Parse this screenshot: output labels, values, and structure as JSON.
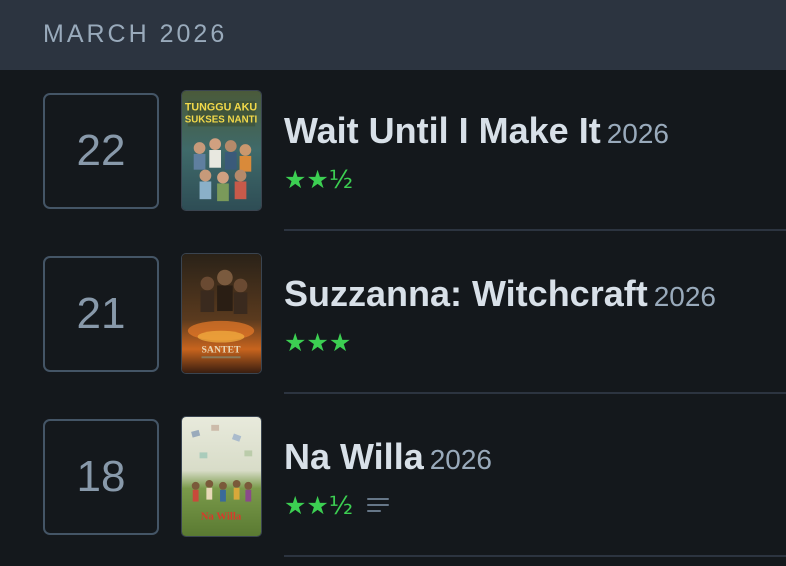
{
  "month_header": {
    "label": "MARCH 2026"
  },
  "entries": [
    {
      "day": "22",
      "title": "Wait Until I Make It",
      "year": "2026",
      "rating_stars": "★★½",
      "rating_value": 2.5,
      "has_review": false,
      "poster_text": "TUNGGU AKU SUKSES NANTI",
      "poster_icon": "poster-image"
    },
    {
      "day": "21",
      "title": "Suzzanna: Witchcraft",
      "year": "2026",
      "rating_stars": "★★★",
      "rating_value": 3,
      "has_review": false,
      "poster_text": "SANTET",
      "poster_icon": "poster-image"
    },
    {
      "day": "18",
      "title": "Na Willa",
      "year": "2026",
      "rating_stars": "★★½",
      "rating_value": 2.5,
      "has_review": true,
      "poster_text": "Na Willa",
      "poster_icon": "poster-image"
    }
  ],
  "colors": {
    "background": "#14181c",
    "header": "#2c3440",
    "star_green": "#3ccf52",
    "title": "#d8e0e8",
    "muted": "#99aabb"
  }
}
